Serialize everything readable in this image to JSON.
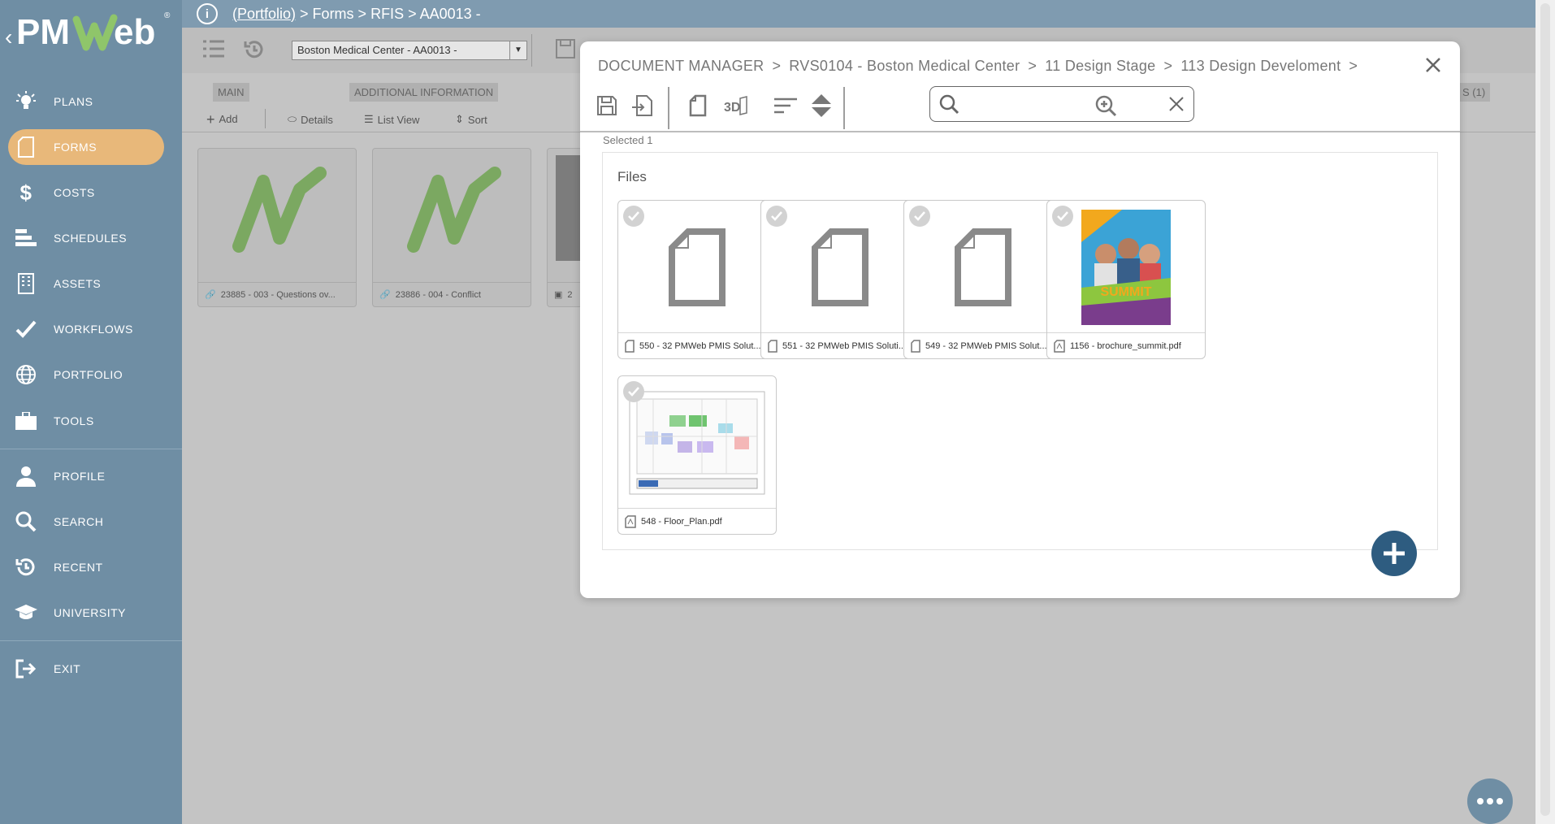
{
  "app": {
    "logo_text": "PMWeb",
    "logo_reg": "®"
  },
  "sidebar": {
    "items": [
      {
        "label": "PLANS",
        "icon": "lightbulb-icon"
      },
      {
        "label": "FORMS",
        "icon": "document-icon",
        "active": true
      },
      {
        "label": "COSTS",
        "icon": "dollar-icon"
      },
      {
        "label": "SCHEDULES",
        "icon": "schedule-bars-icon"
      },
      {
        "label": "ASSETS",
        "icon": "building-icon"
      },
      {
        "label": "WORKFLOWS",
        "icon": "checkmark-icon"
      },
      {
        "label": "PORTFOLIO",
        "icon": "globe-icon"
      },
      {
        "label": "TOOLS",
        "icon": "toolbox-icon"
      },
      {
        "label": "PROFILE",
        "icon": "user-icon"
      },
      {
        "label": "SEARCH",
        "icon": "search-icon"
      },
      {
        "label": "RECENT",
        "icon": "recent-history-icon"
      },
      {
        "label": "UNIVERSITY",
        "icon": "graduation-cap-icon"
      },
      {
        "label": "EXIT",
        "icon": "exit-icon"
      }
    ]
  },
  "topbar": {
    "breadcrumb_link": "(Portfolio)",
    "breadcrumb_rest": "> Forms > RFIS > AA0013 -"
  },
  "toolbar": {
    "project_select": "Boston Medical Center - AA0013 -"
  },
  "tabs": {
    "main": "MAIN",
    "additional": "ADDITIONAL INFORMATION",
    "right_tab": "S (1)"
  },
  "actions": {
    "add": "Add",
    "details": "Details",
    "list_view": "List View",
    "sort": "Sort"
  },
  "background_cards": [
    {
      "caption": "23885 - 003 - Questions ov..."
    },
    {
      "caption": "23886 - 004 - Conflict"
    },
    {
      "caption": "2"
    }
  ],
  "modal": {
    "title_parts": [
      "DOCUMENT MANAGER",
      "RVS0104 - Boston Medical Center",
      "11 Design Stage",
      "113 Design Develoment"
    ],
    "separator": ">",
    "search_value": "",
    "selected_label": "Selected 1",
    "files_title": "Files",
    "files": [
      {
        "caption": "550 - 32 PMWeb PMIS Solut...",
        "type": "generic"
      },
      {
        "caption": "551 - 32 PMWeb PMIS Soluti...",
        "type": "generic"
      },
      {
        "caption": "549 - 32 PMWeb PMIS Solut...",
        "type": "generic"
      },
      {
        "caption": "1156 - brochure_summit.pdf",
        "type": "brochure",
        "thumb_text": "SUMMIT"
      },
      {
        "caption": "548 - Floor_Plan.pdf",
        "type": "floorplan"
      }
    ]
  },
  "colors": {
    "sidebar": "#6f8ea4",
    "active_nav": "#e8b87a",
    "fab": "#2e5c80"
  }
}
